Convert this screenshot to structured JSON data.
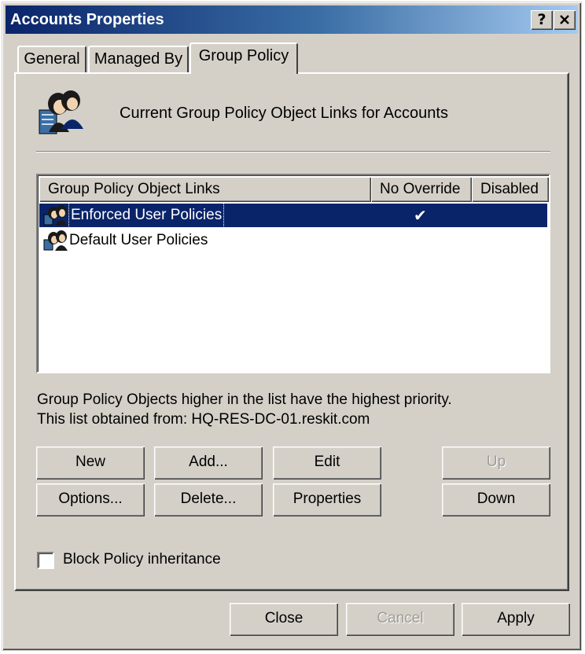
{
  "window": {
    "title": "Accounts Properties",
    "help_label": "?",
    "close_label": "✕"
  },
  "tabs": [
    {
      "label": "General"
    },
    {
      "label": "Managed By"
    },
    {
      "label": "Group Policy",
      "active": true
    }
  ],
  "header": {
    "icon": "users-group-icon",
    "text": "Current Group Policy Object Links for Accounts"
  },
  "list": {
    "columns": [
      "Group Policy Object Links",
      "No Override",
      "Disabled"
    ],
    "rows": [
      {
        "name": "Enforced User Policies",
        "no_override": "✔",
        "disabled": "",
        "selected": true
      },
      {
        "name": "Default User Policies",
        "no_override": "",
        "disabled": "",
        "selected": false
      }
    ]
  },
  "info": {
    "priority_note": "Group Policy Objects higher in the list have the highest priority.",
    "source_note": "This list obtained from:  HQ-RES-DC-01.reskit.com"
  },
  "buttons": {
    "new": "New",
    "add": "Add...",
    "edit": "Edit",
    "up": "Up",
    "options": "Options...",
    "delete": "Delete...",
    "properties": "Properties",
    "down": "Down"
  },
  "block_inheritance": {
    "label": "Block Policy inheritance",
    "checked": false
  },
  "footer": {
    "close": "Close",
    "cancel": "Cancel",
    "apply": "Apply"
  },
  "colors": {
    "face": "#d4d0c8",
    "title_start": "#0a246a",
    "title_end": "#a6caf0",
    "selection": "#0a246a"
  }
}
